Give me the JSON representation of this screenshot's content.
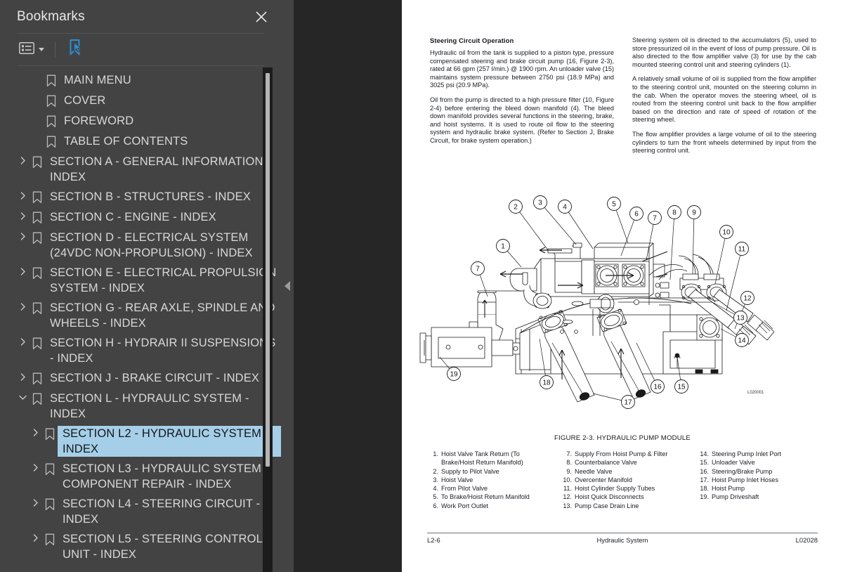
{
  "panel": {
    "title": "Bookmarks",
    "close_icon": "close-icon",
    "toolbar": {
      "options_icon": "list-options-icon",
      "options_caret": "chevron-down-icon",
      "new_bookmark_icon": "new-bookmark-icon"
    }
  },
  "bookmarks": [
    {
      "label": "MAIN MENU",
      "depth": 0,
      "twisty": "none"
    },
    {
      "label": "COVER",
      "depth": 0,
      "twisty": "none"
    },
    {
      "label": "FOREWORD",
      "depth": 0,
      "twisty": "none"
    },
    {
      "label": "TABLE OF CONTENTS",
      "depth": 0,
      "twisty": "none"
    },
    {
      "label": "SECTION A - GENERAL INFORMATION - INDEX",
      "depth": 0,
      "twisty": "collapsed"
    },
    {
      "label": "SECTION B - STRUCTURES - INDEX",
      "depth": 0,
      "twisty": "collapsed"
    },
    {
      "label": "SECTION C - ENGINE - INDEX",
      "depth": 0,
      "twisty": "collapsed"
    },
    {
      "label": "SECTION D - ELECTRICAL SYSTEM (24VDC NON-PROPULSION) - INDEX",
      "depth": 0,
      "twisty": "collapsed"
    },
    {
      "label": "SECTION E - ELECTRICAL PROPULSION SYSTEM - INDEX",
      "depth": 0,
      "twisty": "collapsed"
    },
    {
      "label": "SECTION G - REAR AXLE, SPINDLE AND WHEELS - INDEX",
      "depth": 0,
      "twisty": "collapsed"
    },
    {
      "label": "SECTION H - HYDRAIR II SUSPENSIONS - INDEX",
      "depth": 0,
      "twisty": "collapsed"
    },
    {
      "label": "SECTION J - BRAKE CIRCUIT - INDEX",
      "depth": 0,
      "twisty": "collapsed"
    },
    {
      "label": "SECTION L - HYDRAULIC SYSTEM - INDEX",
      "depth": 0,
      "twisty": "expanded"
    },
    {
      "label": "SECTION L2 - HYDRAULIC SYSTEM - INDEX",
      "depth": 1,
      "twisty": "collapsed",
      "selected": true
    },
    {
      "label": "SECTION L3 - HYDRAULIC SYSTEM COMPONENT REPAIR - INDEX",
      "depth": 1,
      "twisty": "collapsed"
    },
    {
      "label": "SECTION L4 - STEERING CIRCUIT - INDEX",
      "depth": 1,
      "twisty": "collapsed"
    },
    {
      "label": "SECTION L5 - STEERING CONTROL UNIT - INDEX",
      "depth": 1,
      "twisty": "collapsed"
    }
  ],
  "splitter": {
    "handle_icon": "collapse-left-icon"
  },
  "document": {
    "heading": "Steering Circuit Operation",
    "col_left": [
      "Hydraulic oil from the tank is supplied to a piston type, pressure compensated steering and brake circuit pump (16, Figure 2-3), rated at 66 gpm (257 l/min.) @ 1900 rpm. An unloader valve (15) maintains system pressure between 2750 psi (18.9 MPa) and 3025 psi (20.9 MPa).",
      "Oil from the pump is directed to a high pressure filter (10, Figure 2-4) before entering the bleed down manifold (4). The bleed down manifold provides several functions in the steering, brake, and hoist systems. It is used to route oil flow to the steering system and hydraulic brake system. (Refer to Section J, Brake Circuit, for brake system operation.)"
    ],
    "col_right": [
      "Steering system oil is directed to the accumulators (5), used to store pressurized oil in the event of loss of pump pressure. Oil is also directed to the flow amplifier valve (3) for use by the cab mounted steering control unit and steering cylinders (1).",
      "A relatively small volume of oil is supplied from the flow amplifier to the steering control unit, mounted on the steering column in the cab. When the operator moves the steering wheel, oil is routed from the steering control unit back to the flow amplifier based on the direction and rate of speed of rotation of the steering wheel.",
      "The flow amplifier provides a large volume of oil to the steering cylinders to turn the front wheels determined by input from the steering control unit."
    ],
    "figure_caption": "FIGURE 2-3. HYDRAULIC PUMP MODULE",
    "figure_code": "L020001",
    "legend_col1": [
      {
        "n": "1.",
        "t": "Hoist Valve Tank Return (To Brake/Hoist Return Manifold)"
      },
      {
        "n": "2.",
        "t": "Supply to Pilot Valve"
      },
      {
        "n": "3.",
        "t": "Hoist Valve"
      },
      {
        "n": "4.",
        "t": "From Pilot Valve"
      },
      {
        "n": "5.",
        "t": "To Brake/Hoist Return Manifold"
      },
      {
        "n": "6.",
        "t": "Work Port Outlet"
      }
    ],
    "legend_col2": [
      {
        "n": "7.",
        "t": "Supply From Hoist Pump & Filter"
      },
      {
        "n": "8.",
        "t": "Counterbalance Valve"
      },
      {
        "n": "9.",
        "t": "Needle Valve"
      },
      {
        "n": "10.",
        "t": "Overcenter Manifold"
      },
      {
        "n": "11.",
        "t": "Hoist Cylinder Supply Tubes"
      },
      {
        "n": "12.",
        "t": "Hoist Quick Disconnects"
      },
      {
        "n": "13.",
        "t": "Pump Case Drain Line"
      }
    ],
    "legend_col3": [
      {
        "n": "14.",
        "t": "Steering Pump Inlet Port"
      },
      {
        "n": "15.",
        "t": "Unloader Valve"
      },
      {
        "n": "16.",
        "t": "Steering/Brake Pump"
      },
      {
        "n": "17.",
        "t": "Hoist Pump Inlet Hoses"
      },
      {
        "n": "18.",
        "t": "Hoist Pump"
      },
      {
        "n": "19.",
        "t": "Pump Driveshaft"
      }
    ],
    "footer_left": "L2-6",
    "footer_center": "Hydraulic System",
    "footer_right": "L02028",
    "callouts": [
      "1",
      "2",
      "3",
      "4",
      "5",
      "6",
      "7",
      "7",
      "8",
      "9",
      "10",
      "11",
      "12",
      "13",
      "14",
      "15",
      "16",
      "17",
      "18",
      "19"
    ]
  },
  "colors": {
    "panel_bg": "#434343",
    "viewer_bg": "#262626",
    "selection": "#a5cfe8",
    "accent_blue": "#2a8ed4",
    "text": "#d8d8d8"
  }
}
